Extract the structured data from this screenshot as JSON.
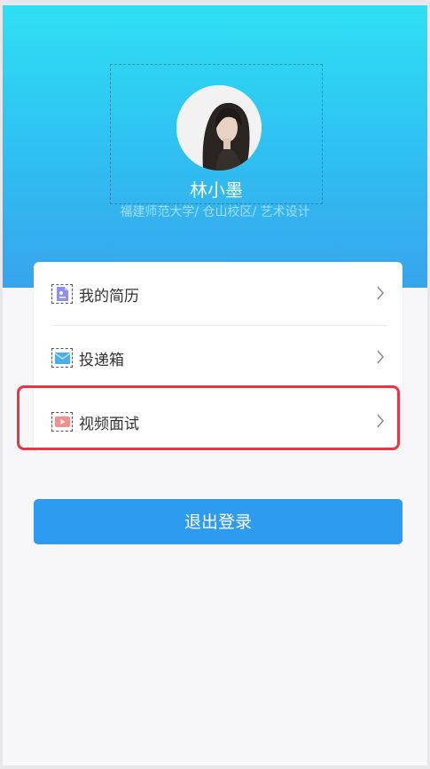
{
  "profile": {
    "name": "林小墨",
    "school": "福建师范大学/ 仓山校区/ 艺术设计"
  },
  "menu": {
    "items": [
      {
        "label": "我的简历",
        "icon": "resume-icon"
      },
      {
        "label": "投递箱",
        "icon": "mailbox-icon"
      },
      {
        "label": "视频面试",
        "icon": "video-icon"
      }
    ]
  },
  "logout": {
    "label": "退出登录"
  },
  "colors": {
    "header_top": "#2fe0f2",
    "header_bottom": "#37a4ec",
    "button": "#2d9cf0",
    "highlight": "#ee3344"
  }
}
